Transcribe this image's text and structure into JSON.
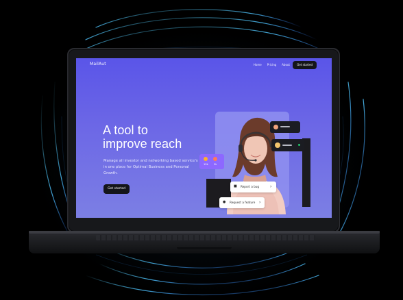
{
  "site": {
    "logo": "MailAut",
    "nav": [
      "Home",
      "Pricing",
      "About"
    ],
    "nav_cta": "Get started"
  },
  "hero": {
    "title_line1": "A tool to",
    "title_line2": "improve reach",
    "subtitle": "Manage all investor and networking based service's in one place for Optimal Business and Personal Growth.",
    "cta": "Get started"
  },
  "widgets": {
    "reactions": [
      {
        "emoji": "laughing-face-icon",
        "count": "19k"
      },
      {
        "emoji": "heart-eyes-face-icon",
        "count": "2k"
      }
    ],
    "report_bug": "Report a bug",
    "request_feature": "Request a feature",
    "status_dots": {
      "first": "#8f95a8",
      "second": "#24c36a"
    }
  },
  "colors": {
    "screen_top": "#5a55e8",
    "screen_bottom": "#7c7fe4",
    "dark": "#15161a",
    "accent_purple": "#8d68ff"
  }
}
